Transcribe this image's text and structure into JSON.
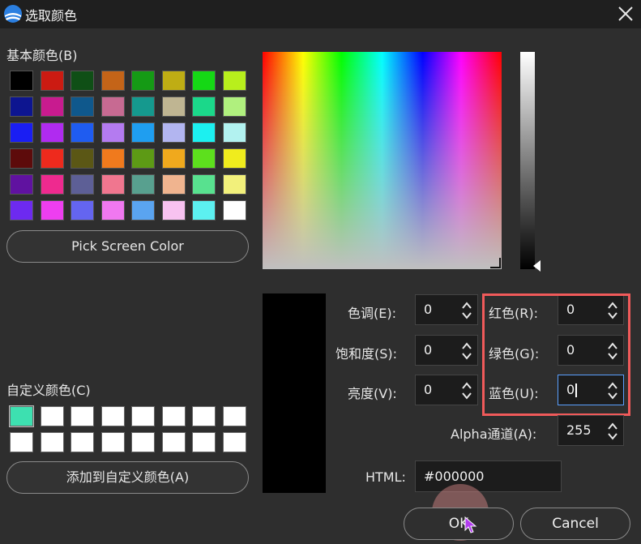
{
  "window": {
    "title": "选取颜色"
  },
  "basic_colors": {
    "label": "基本颜色(B)",
    "rows": [
      [
        "#000000",
        "#cc1b12",
        "#0f4f16",
        "#c46418",
        "#159a15",
        "#bfad14",
        "#15d815",
        "#b8ef1c"
      ],
      [
        "#0d1590",
        "#c81b8f",
        "#0f588c",
        "#c76a92",
        "#15998e",
        "#bfb592",
        "#1bd88a",
        "#b0f07e"
      ],
      [
        "#1a1ef3",
        "#b02bf0",
        "#1f5cf0",
        "#b47bf0",
        "#1f9ef0",
        "#b2b5f0",
        "#1cf0f0",
        "#b2f2f0"
      ],
      [
        "#5d0b0b",
        "#ee2a1d",
        "#5b5715",
        "#f07a1d",
        "#5d9a15",
        "#f0a91d",
        "#5de01d",
        "#f0ec1d"
      ],
      [
        "#6012a0",
        "#ee2a8f",
        "#5d5f96",
        "#f0768f",
        "#58a08f",
        "#f0b48f",
        "#58e18f",
        "#f2f07b"
      ],
      [
        "#6d2af0",
        "#ee3ef0",
        "#6465f0",
        "#f078f0",
        "#5aa4f0",
        "#f8c2f0",
        "#5cf0f0",
        "#ffffff"
      ]
    ]
  },
  "pick_screen_button": "Pick Screen Color",
  "custom_colors": {
    "label": "自定义颜色(C)",
    "rows": [
      [
        "#3de0b0",
        "#ffffff",
        "#ffffff",
        "#ffffff",
        "#ffffff",
        "#ffffff",
        "#ffffff",
        "#ffffff"
      ],
      [
        "#ffffff",
        "#ffffff",
        "#ffffff",
        "#ffffff",
        "#ffffff",
        "#ffffff",
        "#ffffff",
        "#ffffff"
      ]
    ]
  },
  "add_custom_button": "添加到自定义颜色(A)",
  "fields": {
    "hue": {
      "label": "色调(E):",
      "value": "0"
    },
    "saturation": {
      "label": "饱和度(S):",
      "value": "0"
    },
    "value": {
      "label": "亮度(V):",
      "value": "0"
    },
    "red": {
      "label": "红色(R):",
      "value": "0"
    },
    "green": {
      "label": "绿色(G):",
      "value": "0"
    },
    "blue": {
      "label": "蓝色(U):",
      "value": "0"
    },
    "alpha": {
      "label": "Alpha通道(A):",
      "value": "255"
    },
    "html": {
      "label": "HTML:",
      "value": "#000000"
    }
  },
  "buttons": {
    "ok": "OK",
    "cancel": "Cancel"
  },
  "colors": {
    "highlight": "#f05a5a",
    "current_color": "#000000",
    "focus": "#5aa0ff"
  }
}
